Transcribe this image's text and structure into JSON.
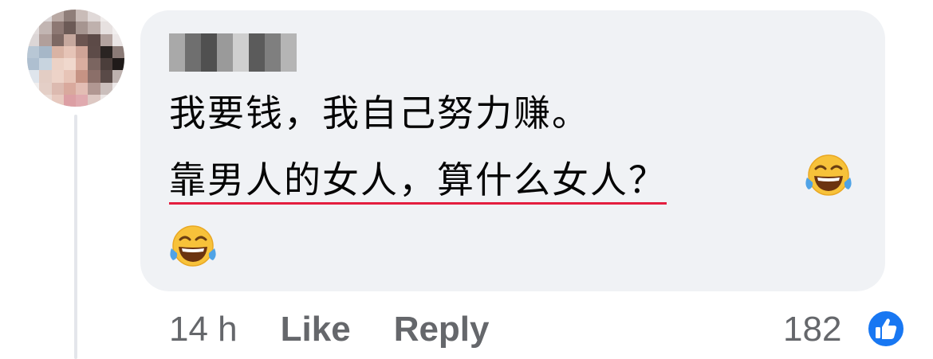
{
  "comment": {
    "line1": "我要钱，我自己努力赚。",
    "line2": "靠男人的女人，算什么女人？"
  },
  "emojis": {
    "first": "face-with-tears-of-joy-icon",
    "second": "face-with-tears-of-joy-icon"
  },
  "actions": {
    "timestamp": "14 h",
    "like_label": "Like",
    "reply_label": "Reply"
  },
  "reactions": {
    "count": "182",
    "icon": "thumbs-up-icon"
  },
  "colors": {
    "bubble": "#f0f2f5",
    "text": "#050505",
    "meta": "#65676b",
    "like_blue": "#1877f2",
    "underline": "#e41e3f"
  }
}
